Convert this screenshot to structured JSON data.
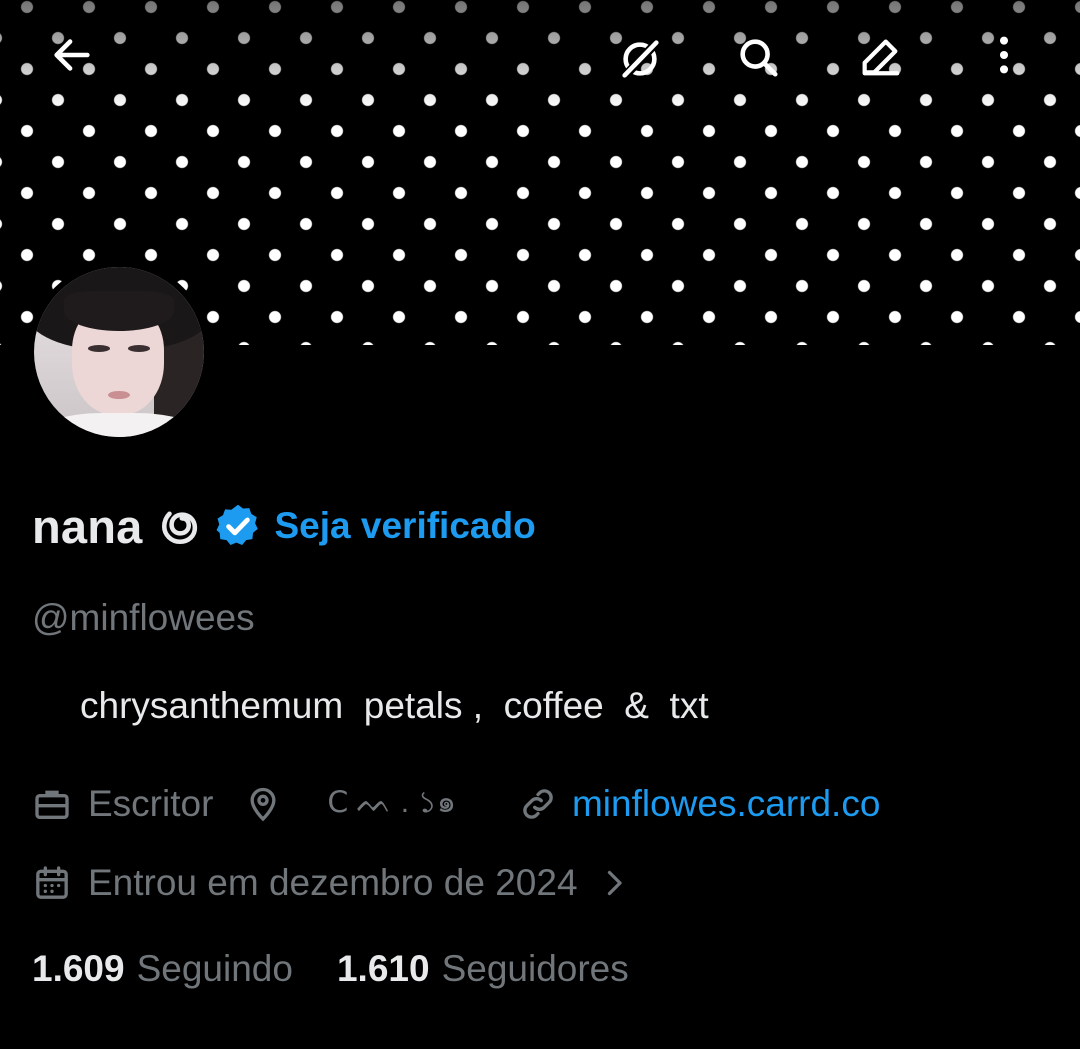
{
  "banner": {
    "pattern": "white polka dots on black"
  },
  "topbar": {
    "back_icon": "arrow-left-icon",
    "grok_icon": "grok-icon",
    "search_icon": "search-icon",
    "edit_icon": "edit-icon",
    "more_icon": "more-vertical-icon"
  },
  "profile": {
    "display_name": "nana",
    "emblem_icon": "swirl-emblem-icon",
    "verified_icon": "verified-badge-icon",
    "get_verified_label": "Seja verificado",
    "handle": "@minflowees",
    "bio": "chrysanthemum  petals ,  coffee  &  txt",
    "profession_icon": "briefcase-icon",
    "profession": "Escritor",
    "location_icon": "location-pin-icon",
    "location": "ꓚ ᨓ . ১๑",
    "link_icon": "link-icon",
    "link": "minflowes.carrd.co",
    "calendar_icon": "calendar-icon",
    "joined": "Entrou em dezembro de 2024",
    "chevron_icon": "chevron-right-icon",
    "following_count": "1.609",
    "following_label": "Seguindo",
    "followers_count": "1.610",
    "followers_label": "Seguidores"
  },
  "colors": {
    "background": "#000000",
    "accent": "#1d9bf0",
    "text_primary": "#e7e9ea",
    "text_secondary": "#71767b"
  }
}
